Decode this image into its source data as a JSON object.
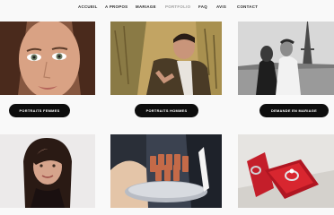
{
  "nav": {
    "items": [
      {
        "label": "ACCUEIL"
      },
      {
        "label": "A PROPOS"
      },
      {
        "label": "MARIAGE"
      },
      {
        "label": "PORTFOLIO"
      },
      {
        "label": "FAQ"
      },
      {
        "label": "AVIS"
      },
      {
        "label": "CONTACT"
      }
    ],
    "active_index": 3
  },
  "gallery": {
    "buttons": [
      {
        "label": "PORTRAITS FEMMES"
      },
      {
        "label": "PORTRAITS HOMMES"
      },
      {
        "label": "DEMANDE EN MARIAGE"
      }
    ]
  },
  "colors": {
    "background": "#f9f9f9",
    "button_bg": "#0d0d0d",
    "button_text": "#ffffff",
    "nav_text": "#2b2b2b",
    "nav_active": "#9e9e9e"
  }
}
